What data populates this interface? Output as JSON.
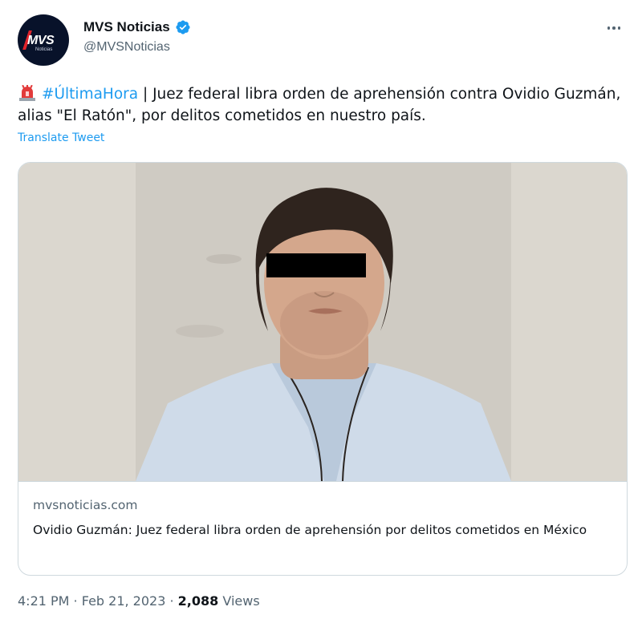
{
  "account": {
    "display_name": "MVS Noticias",
    "handle": "@MVSNoticias",
    "avatar_logo_text": "MVS",
    "avatar_logo_subtext": "Noticias",
    "verified_icon": "verified-badge-icon",
    "more_icon": "more-options-icon"
  },
  "tweet": {
    "emoji_icon": "siren-icon",
    "hashtag": "#ÚltimaHora",
    "text": " | Juez federal libra orden de aprehensión contra Ovidio Guzmán, alias \"El Ratón\", por delitos cometidos en nuestro país.",
    "translate_label": "Translate Tweet"
  },
  "card": {
    "domain": "mvsnoticias.com",
    "title": "Ovidio Guzmán: Juez federal libra orden de aprehensión por delitos cometidos en México"
  },
  "footer": {
    "time": "4:21 PM",
    "separator": " · ",
    "date": "Feb 21, 2023",
    "views_count": "2,088",
    "views_label": "Views"
  },
  "colors": {
    "accent": "#1d9bf0",
    "text_primary": "#0f1419",
    "text_secondary": "#536471",
    "border": "#cfd9de"
  }
}
